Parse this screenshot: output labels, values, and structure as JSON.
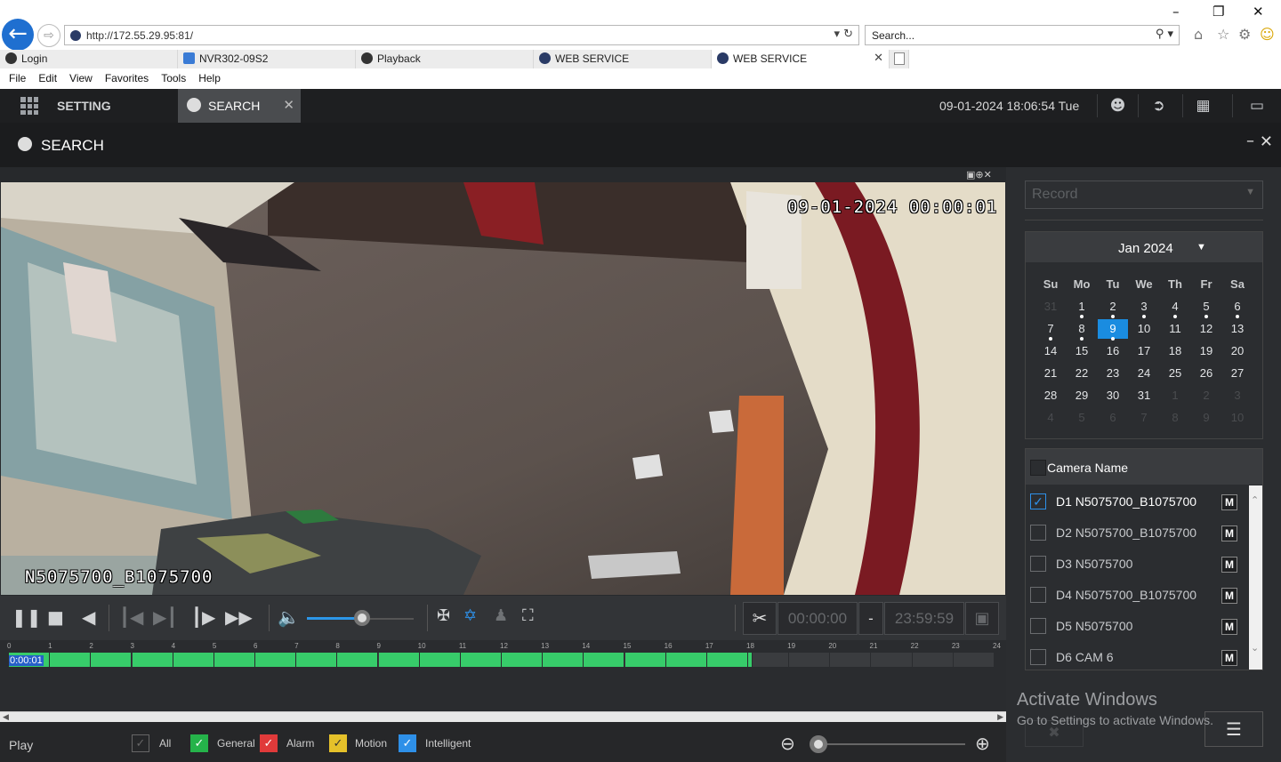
{
  "browser": {
    "url": "http://172.55.29.95:81/",
    "search_placeholder": "Search...",
    "tabs": [
      {
        "label": "Login"
      },
      {
        "label": "NVR302-09S2"
      },
      {
        "label": "Playback"
      },
      {
        "label": "WEB SERVICE"
      },
      {
        "label": "WEB SERVICE"
      }
    ],
    "menu": [
      "File",
      "Edit",
      "View",
      "Favorites",
      "Tools",
      "Help"
    ]
  },
  "app": {
    "setting_label": "SETTING",
    "search_tab_label": "SEARCH",
    "datetime": "09-01-2024 18:06:54 Tue",
    "panel_title": "SEARCH"
  },
  "video": {
    "timestamp_osd": "09-01-2024 00:00:01",
    "camera_osd": "N5075700_B1075700"
  },
  "playback": {
    "clip_start": "00:00:00",
    "clip_dash": "-",
    "clip_end": "23:59:59",
    "volume_level": 0.52
  },
  "timeline": {
    "hours": [
      "0",
      "1",
      "2",
      "3",
      "4",
      "5",
      "6",
      "7",
      "8",
      "9",
      "10",
      "11",
      "12",
      "13",
      "14",
      "15",
      "16",
      "17",
      "18",
      "19",
      "20",
      "21",
      "22",
      "23",
      "24"
    ],
    "recorded_until_hour": 18.1,
    "cursor_time": "0:00:01",
    "colors": {
      "recorded": "#37cc6a"
    }
  },
  "bottom": {
    "play_label": "Play",
    "filters": [
      {
        "label": "All",
        "checked": true,
        "color": "#262729"
      },
      {
        "label": "General",
        "checked": true,
        "color": "#25b34a"
      },
      {
        "label": "Alarm",
        "checked": true,
        "color": "#e03a3a"
      },
      {
        "label": "Motion",
        "checked": true,
        "color": "#e5c12a"
      },
      {
        "label": "Intelligent",
        "checked": true,
        "color": "#2e90e8"
      }
    ]
  },
  "right_panel": {
    "record_type": "Record",
    "calendar": {
      "month": "Jan 2024",
      "weekdays": [
        "Su",
        "Mo",
        "Tu",
        "We",
        "Th",
        "Fr",
        "Sa"
      ],
      "days": [
        [
          "31",
          "1",
          "2",
          "3",
          "4",
          "5",
          "6"
        ],
        [
          "7",
          "8",
          "9",
          "10",
          "11",
          "12",
          "13"
        ],
        [
          "14",
          "15",
          "16",
          "17",
          "18",
          "19",
          "20"
        ],
        [
          "21",
          "22",
          "23",
          "24",
          "25",
          "26",
          "27"
        ],
        [
          "28",
          "29",
          "30",
          "31",
          "1",
          "2",
          "3"
        ],
        [
          "4",
          "5",
          "6",
          "7",
          "8",
          "9",
          "10"
        ]
      ],
      "selected_day": "9",
      "days_with_records": [
        "1",
        "2",
        "3",
        "4",
        "5",
        "6",
        "7",
        "8",
        "9"
      ]
    },
    "camera_header": "Camera Name",
    "cameras": [
      {
        "name": "D1 N5075700_B1075700",
        "checked": true,
        "main_label": "M"
      },
      {
        "name": "D2 N5075700_B1075700",
        "checked": false,
        "main_label": "M"
      },
      {
        "name": "D3 N5075700",
        "checked": false,
        "main_label": "M"
      },
      {
        "name": "D4 N5075700_B1075700",
        "checked": false,
        "main_label": "M"
      },
      {
        "name": "D5 N5075700",
        "checked": false,
        "main_label": "M"
      },
      {
        "name": "D6 CAM 6",
        "checked": false,
        "main_label": "M"
      }
    ]
  },
  "watermark": {
    "title": "Activate Windows",
    "subtitle": "Go to Settings to activate Windows."
  }
}
